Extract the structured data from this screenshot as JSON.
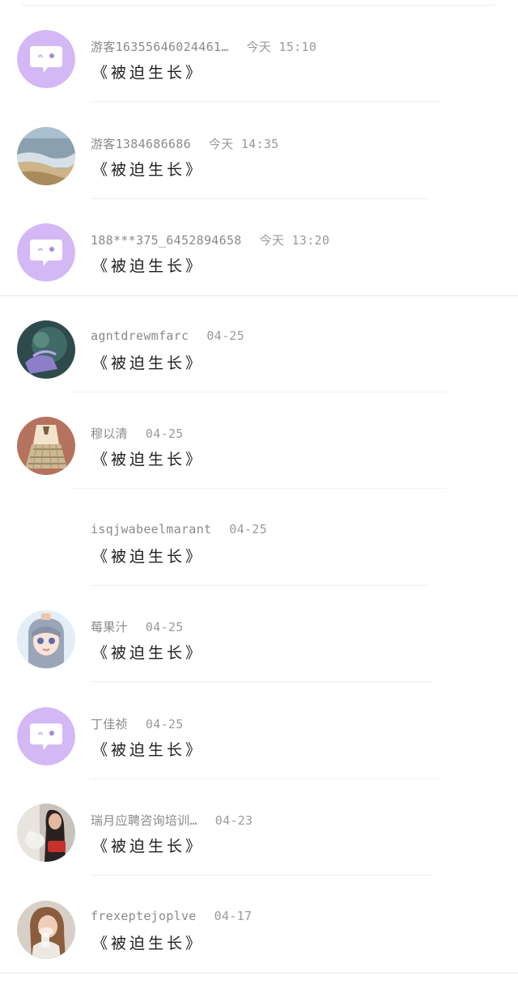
{
  "comments": [
    {
      "username": "游客16355646024461…",
      "time": "今天 15:10",
      "title": "《被迫生长》",
      "avatar": "chat-bubble-icon"
    },
    {
      "username": "游客1384686686",
      "time": "今天 14:35",
      "title": "《被迫生长》",
      "avatar": "beach-photo"
    },
    {
      "username": "188***375_6452894658",
      "time": "今天 13:20",
      "title": "《被迫生长》",
      "avatar": "chat-bubble-icon"
    },
    {
      "username": "agntdrewmfarc",
      "time": "04-25",
      "title": "《被迫生长》",
      "avatar": "dark-art-photo"
    },
    {
      "username": "穆以清",
      "time": "04-25",
      "title": "《被迫生长》",
      "avatar": "anime-uniform-photo"
    },
    {
      "username": "isqjwabeelmarant",
      "time": "04-25",
      "title": "《被迫生长》",
      "avatar": "none"
    },
    {
      "username": "莓果汁",
      "time": "04-25",
      "title": "《被迫生长》",
      "avatar": "anime-girl-photo"
    },
    {
      "username": "丁佳祯",
      "time": "04-25",
      "title": "《被迫生长》",
      "avatar": "chat-bubble-icon"
    },
    {
      "username": "瑞月应聘咨询培训…",
      "time": "04-23",
      "title": "《被迫生长》",
      "avatar": "woman-cat-photo"
    },
    {
      "username": "frexeptejoplve",
      "time": "04-17",
      "title": "《被迫生长》",
      "avatar": "woman-drink-photo"
    }
  ],
  "colors": {
    "default_avatar_bg": "#d3b8f5",
    "meta_text": "#8a8a8a",
    "title_text": "#1e1e1e",
    "divider": "#efefef"
  }
}
